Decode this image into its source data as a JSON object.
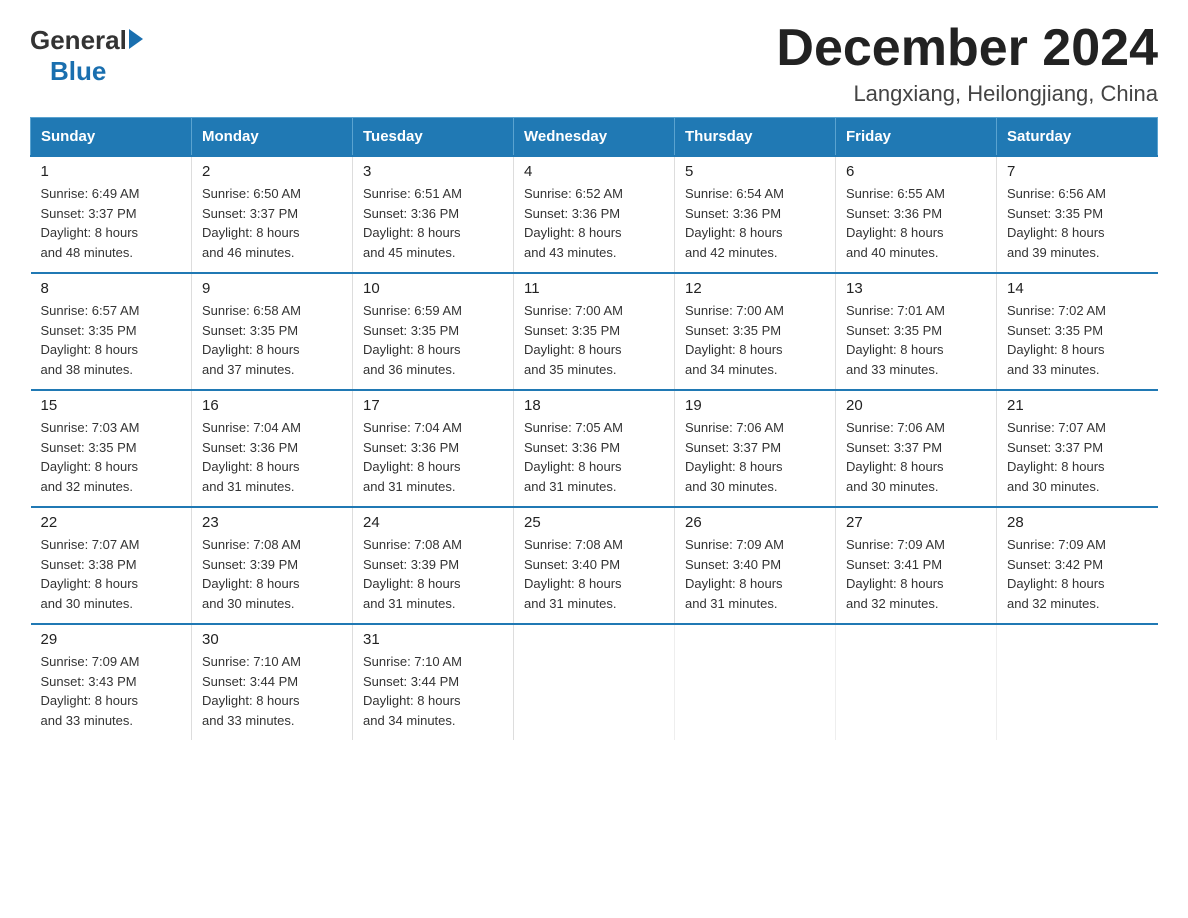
{
  "logo": {
    "general": "General",
    "blue": "Blue"
  },
  "title": "December 2024",
  "subtitle": "Langxiang, Heilongjiang, China",
  "weekdays": [
    "Sunday",
    "Monday",
    "Tuesday",
    "Wednesday",
    "Thursday",
    "Friday",
    "Saturday"
  ],
  "weeks": [
    [
      {
        "day": "1",
        "sunrise": "6:49 AM",
        "sunset": "3:37 PM",
        "daylight": "8 hours and 48 minutes."
      },
      {
        "day": "2",
        "sunrise": "6:50 AM",
        "sunset": "3:37 PM",
        "daylight": "8 hours and 46 minutes."
      },
      {
        "day": "3",
        "sunrise": "6:51 AM",
        "sunset": "3:36 PM",
        "daylight": "8 hours and 45 minutes."
      },
      {
        "day": "4",
        "sunrise": "6:52 AM",
        "sunset": "3:36 PM",
        "daylight": "8 hours and 43 minutes."
      },
      {
        "day": "5",
        "sunrise": "6:54 AM",
        "sunset": "3:36 PM",
        "daylight": "8 hours and 42 minutes."
      },
      {
        "day": "6",
        "sunrise": "6:55 AM",
        "sunset": "3:36 PM",
        "daylight": "8 hours and 40 minutes."
      },
      {
        "day": "7",
        "sunrise": "6:56 AM",
        "sunset": "3:35 PM",
        "daylight": "8 hours and 39 minutes."
      }
    ],
    [
      {
        "day": "8",
        "sunrise": "6:57 AM",
        "sunset": "3:35 PM",
        "daylight": "8 hours and 38 minutes."
      },
      {
        "day": "9",
        "sunrise": "6:58 AM",
        "sunset": "3:35 PM",
        "daylight": "8 hours and 37 minutes."
      },
      {
        "day": "10",
        "sunrise": "6:59 AM",
        "sunset": "3:35 PM",
        "daylight": "8 hours and 36 minutes."
      },
      {
        "day": "11",
        "sunrise": "7:00 AM",
        "sunset": "3:35 PM",
        "daylight": "8 hours and 35 minutes."
      },
      {
        "day": "12",
        "sunrise": "7:00 AM",
        "sunset": "3:35 PM",
        "daylight": "8 hours and 34 minutes."
      },
      {
        "day": "13",
        "sunrise": "7:01 AM",
        "sunset": "3:35 PM",
        "daylight": "8 hours and 33 minutes."
      },
      {
        "day": "14",
        "sunrise": "7:02 AM",
        "sunset": "3:35 PM",
        "daylight": "8 hours and 33 minutes."
      }
    ],
    [
      {
        "day": "15",
        "sunrise": "7:03 AM",
        "sunset": "3:35 PM",
        "daylight": "8 hours and 32 minutes."
      },
      {
        "day": "16",
        "sunrise": "7:04 AM",
        "sunset": "3:36 PM",
        "daylight": "8 hours and 31 minutes."
      },
      {
        "day": "17",
        "sunrise": "7:04 AM",
        "sunset": "3:36 PM",
        "daylight": "8 hours and 31 minutes."
      },
      {
        "day": "18",
        "sunrise": "7:05 AM",
        "sunset": "3:36 PM",
        "daylight": "8 hours and 31 minutes."
      },
      {
        "day": "19",
        "sunrise": "7:06 AM",
        "sunset": "3:37 PM",
        "daylight": "8 hours and 30 minutes."
      },
      {
        "day": "20",
        "sunrise": "7:06 AM",
        "sunset": "3:37 PM",
        "daylight": "8 hours and 30 minutes."
      },
      {
        "day": "21",
        "sunrise": "7:07 AM",
        "sunset": "3:37 PM",
        "daylight": "8 hours and 30 minutes."
      }
    ],
    [
      {
        "day": "22",
        "sunrise": "7:07 AM",
        "sunset": "3:38 PM",
        "daylight": "8 hours and 30 minutes."
      },
      {
        "day": "23",
        "sunrise": "7:08 AM",
        "sunset": "3:39 PM",
        "daylight": "8 hours and 30 minutes."
      },
      {
        "day": "24",
        "sunrise": "7:08 AM",
        "sunset": "3:39 PM",
        "daylight": "8 hours and 31 minutes."
      },
      {
        "day": "25",
        "sunrise": "7:08 AM",
        "sunset": "3:40 PM",
        "daylight": "8 hours and 31 minutes."
      },
      {
        "day": "26",
        "sunrise": "7:09 AM",
        "sunset": "3:40 PM",
        "daylight": "8 hours and 31 minutes."
      },
      {
        "day": "27",
        "sunrise": "7:09 AM",
        "sunset": "3:41 PM",
        "daylight": "8 hours and 32 minutes."
      },
      {
        "day": "28",
        "sunrise": "7:09 AM",
        "sunset": "3:42 PM",
        "daylight": "8 hours and 32 minutes."
      }
    ],
    [
      {
        "day": "29",
        "sunrise": "7:09 AM",
        "sunset": "3:43 PM",
        "daylight": "8 hours and 33 minutes."
      },
      {
        "day": "30",
        "sunrise": "7:10 AM",
        "sunset": "3:44 PM",
        "daylight": "8 hours and 33 minutes."
      },
      {
        "day": "31",
        "sunrise": "7:10 AM",
        "sunset": "3:44 PM",
        "daylight": "8 hours and 34 minutes."
      },
      null,
      null,
      null,
      null
    ]
  ],
  "labels": {
    "sunrise": "Sunrise:",
    "sunset": "Sunset:",
    "daylight": "Daylight:"
  }
}
